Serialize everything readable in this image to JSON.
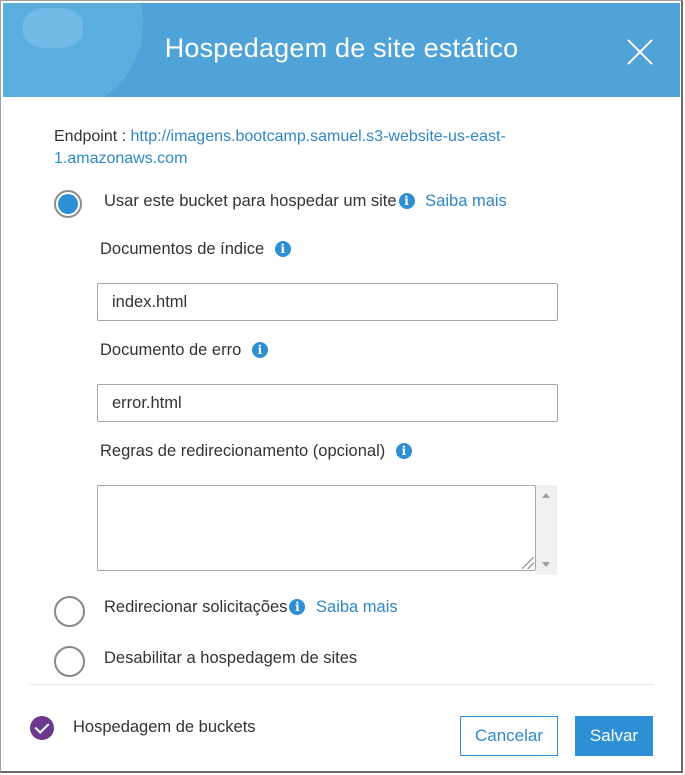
{
  "dialog": {
    "title": "Hospedagem de site estático",
    "close_icon": "close-icon"
  },
  "endpoint": {
    "label": "Endpoint : ",
    "url_line1": "http://imagens.bootcamp.samuel.s3-website-us-east-",
    "url_line2": "1.amazonaws.com"
  },
  "options": {
    "host": {
      "label": "Usar este bucket para hospedar um site",
      "learn_more": "Saiba mais",
      "selected": true
    },
    "redirect": {
      "label": "Redirecionar solicitações",
      "learn_more": "Saiba mais",
      "selected": false
    },
    "disable": {
      "label": "Desabilitar a hospedagem de sites",
      "selected": false
    }
  },
  "fields": {
    "index": {
      "label": "Documentos de índice",
      "value": "index.html"
    },
    "error": {
      "label": "Documento de erro",
      "value": "error.html"
    },
    "redirect_rules": {
      "label": "Regras de redirecionamento (opcional)",
      "value": ""
    }
  },
  "info_glyph": "i",
  "footer": {
    "status_label": "Hospedagem de buckets",
    "cancel_label": "Cancelar",
    "save_label": "Salvar"
  },
  "colors": {
    "header": "#4fa3d8",
    "accent": "#2e90d4",
    "link": "#2f87c8",
    "status_icon": "#6b3a8c"
  }
}
